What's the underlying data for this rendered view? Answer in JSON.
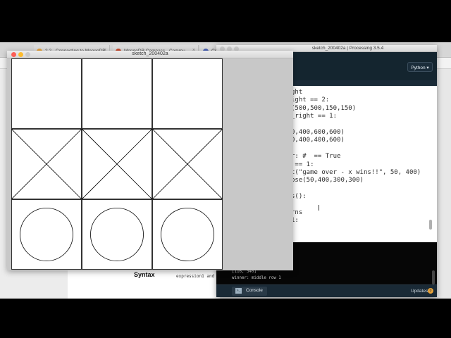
{
  "browser": {
    "tabs": [
      {
        "label": "2.2 - Connecting to MongoDB",
        "favicon_color": "#e8a33a"
      },
      {
        "label": "MongoDB Compass - Commu",
        "favicon_color": "#cc4a2c"
      },
      {
        "label": "Co",
        "favicon_color": "#4a63b8"
      }
    ],
    "close_glyph": "×",
    "page": {
      "syntax_label": "Syntax",
      "syntax_code": "expression1 and"
    }
  },
  "sketch_window": {
    "title": "sketch_200402a",
    "colors": {
      "background": "#c8c8c8",
      "canvas": "#ffffff",
      "stroke": "#000000"
    },
    "board": {
      "rows": [
        [
          "",
          "",
          ""
        ],
        [
          "x",
          "x",
          "x"
        ],
        [
          "o",
          "o",
          "o"
        ]
      ]
    }
  },
  "ide": {
    "title": "sketch_200402a | Processing 3.5.4",
    "mode_label": "Python ▾",
    "code_lines": [
      "ght",
      "ight == 2:",
      "(500,500,150,150)",
      "_right == 1:",
      "",
      "0,400,600,600)",
      "0,400,400,600)",
      "",
      "r: #  == True",
      " == 1:",
      "t(\"game over - x wins!!\", 50, 400)",
      "pse(50,400,300,300)",
      "",
      "s():",
      "",
      "rns",
      "1:"
    ],
    "console_lines": [
      "[116, 340]",
      "winner: middle row 1"
    ],
    "footer": {
      "console_tab": "Console",
      "console_icon": ">_",
      "updates_label": "Updates",
      "updates_count": "0"
    },
    "colors": {
      "toolbar": "#14252f",
      "editor_bg": "#ffffff",
      "console_bg": "#060606"
    }
  }
}
